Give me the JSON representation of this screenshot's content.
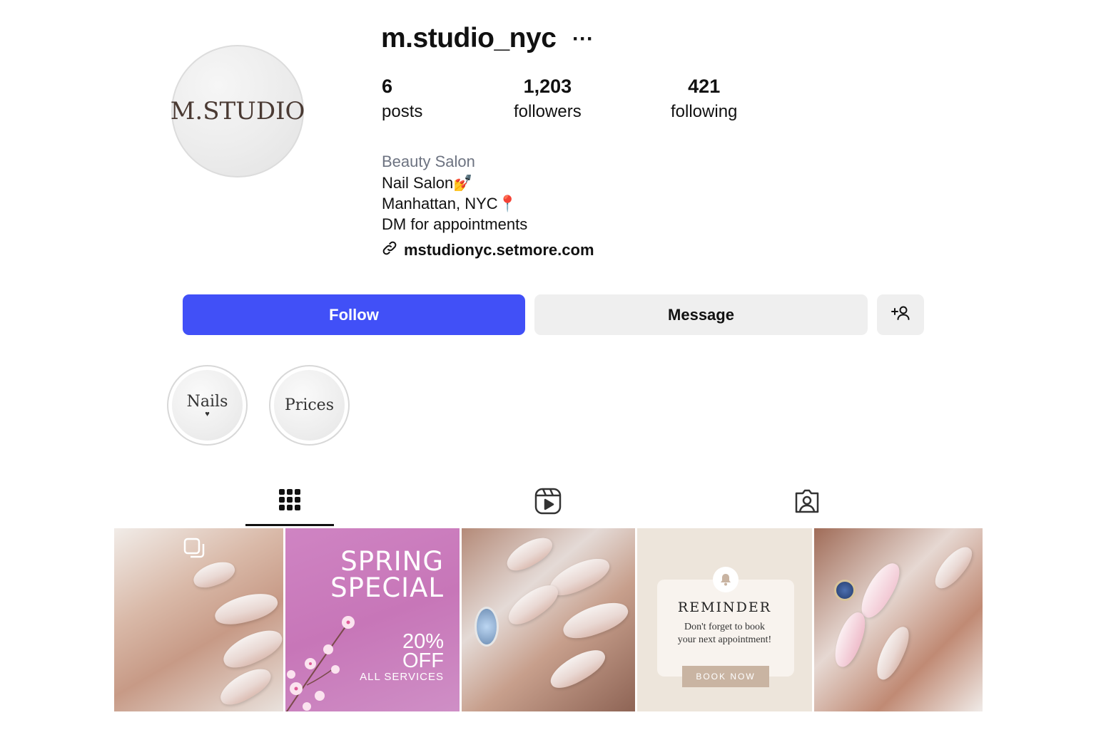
{
  "profile": {
    "avatar_text": "M.STUDIO",
    "username": "m.studio_nyc",
    "more_label": "···"
  },
  "stats": {
    "posts": {
      "count": "6",
      "label": "posts"
    },
    "followers": {
      "count": "1,203",
      "label": "followers"
    },
    "following": {
      "count": "421",
      "label": "following"
    }
  },
  "bio": {
    "category": "Beauty Salon",
    "line1": "Nail Salon💅",
    "line2": "Manhattan, NYC📍",
    "line3": "DM for appointments",
    "link": "mstudionyc.setmore.com"
  },
  "actions": {
    "follow": "Follow",
    "message": "Message",
    "add_user": "+👤"
  },
  "highlights": [
    {
      "label": "Nails"
    },
    {
      "label": "Prices"
    }
  ],
  "tabs": [
    {
      "icon": "grid-icon",
      "active": true
    },
    {
      "icon": "reels-icon",
      "active": false
    },
    {
      "icon": "tagged-icon",
      "active": false
    }
  ],
  "posts": {
    "spring_title": "SPRING SPECIAL",
    "spring_percent": "20%",
    "spring_off": "OFF",
    "spring_all": "ALL SERVICES",
    "reminder_title": "REMINDER",
    "reminder_line1": "Don't forget to book",
    "reminder_line2": "your next appointment!",
    "reminder_button": "BOOK NOW"
  },
  "colors": {
    "follow_button": "#4150f7",
    "secondary_button": "#efefef",
    "category_text": "#6d7381"
  }
}
